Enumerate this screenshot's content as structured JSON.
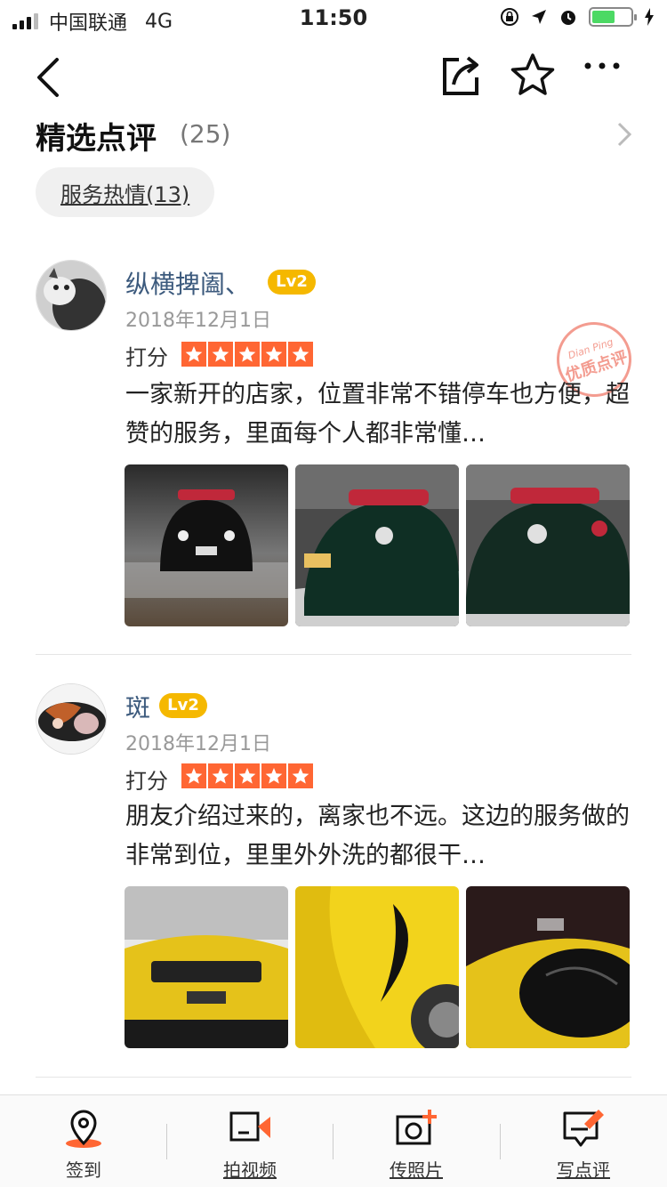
{
  "status_bar": {
    "carrier": "中国联通",
    "network": "4G",
    "time": "11:50"
  },
  "section": {
    "title": "精选点评",
    "count": "(25)",
    "tag": "服务热情(13)"
  },
  "reviews": [
    {
      "username": "纵横捭阖、",
      "level": "Lv2",
      "date": "2018年12月1日",
      "score_label": "打分",
      "stars": 5,
      "text": "一家新开的店家，位置非常不错停车也方便，超赞的服务，里面每个人都非常懂…",
      "stamp_en": "Dian Ping",
      "stamp_cn": "优质点评"
    },
    {
      "username": "斑",
      "level": "Lv2",
      "date": "2018年12月1日",
      "score_label": "打分",
      "stars": 5,
      "text": "朋友介绍过来的，离家也不远。这边的服务做的非常到位，里里外外洗的都很干…"
    }
  ],
  "tabbar": {
    "items": [
      {
        "label": "签到",
        "icon": "location-pin-icon"
      },
      {
        "label": "拍视频",
        "icon": "video-camera-icon"
      },
      {
        "label": "传照片",
        "icon": "photo-camera-icon"
      },
      {
        "label": "写点评",
        "icon": "write-review-icon"
      }
    ]
  },
  "colors": {
    "accent": "#ff6633",
    "level_badge": "#f5b800",
    "username": "#3c5a7d"
  }
}
